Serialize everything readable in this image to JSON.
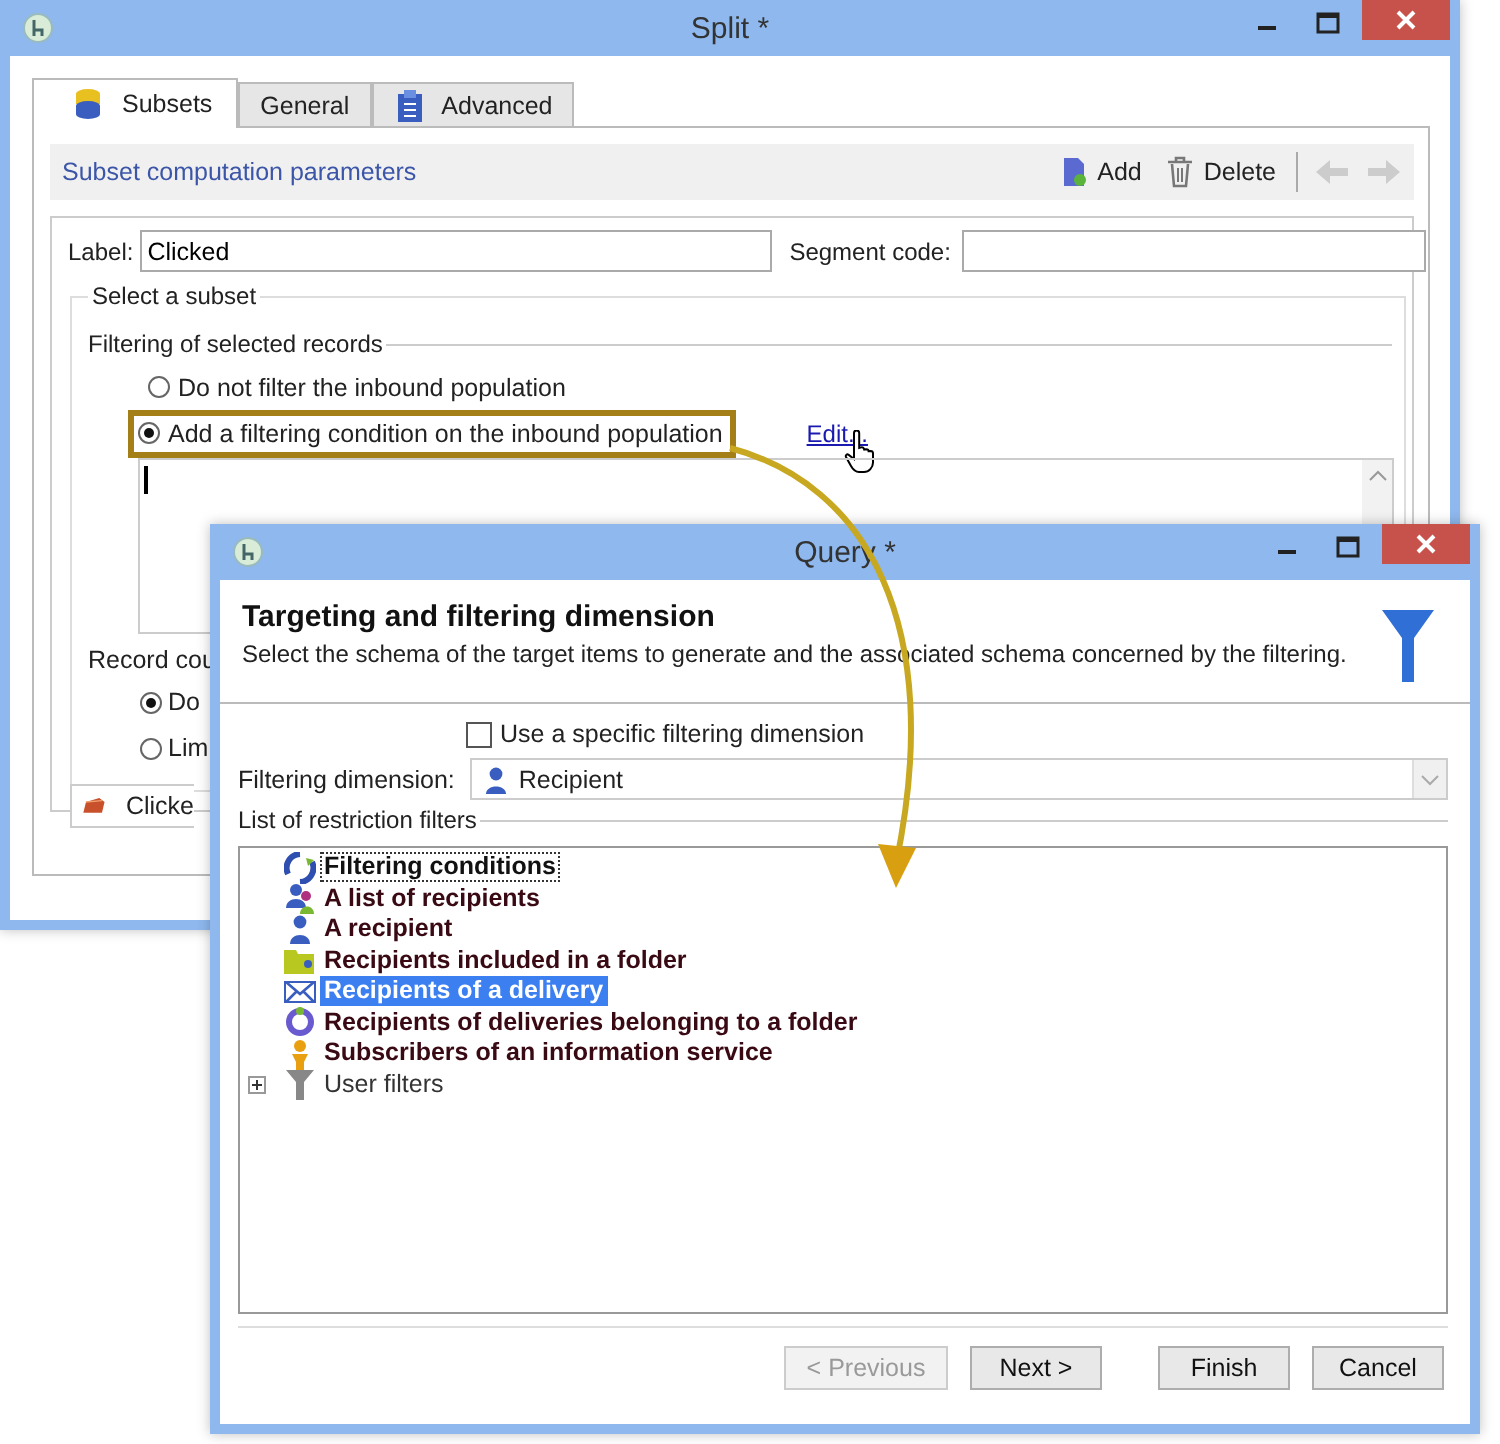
{
  "split_window": {
    "title": "Split *",
    "tabs": [
      {
        "label": "Subsets",
        "selected": true
      },
      {
        "label": "General",
        "selected": false
      },
      {
        "label": "Advanced",
        "selected": false
      }
    ],
    "section_title": "Subset computation parameters",
    "toolbar": [
      {
        "kind": "add",
        "label": "Add"
      },
      {
        "kind": "delete",
        "label": "Delete"
      },
      {
        "kind": "back",
        "disabled": true
      },
      {
        "kind": "forward",
        "disabled": true
      }
    ],
    "label_field": {
      "label": "Label:",
      "value": "Clicked"
    },
    "segment_code": {
      "label": "Segment code:"
    },
    "subset_group": "Select a subset",
    "filter_group": "Filtering of selected records",
    "filter_options": [
      {
        "label": "Do not filter the inbound population",
        "selected": false,
        "highlighted": false
      },
      {
        "label": "Add a filtering condition on the inbound population",
        "selected": true,
        "highlighted": true
      }
    ],
    "edit_link": "Edit...",
    "record_count_label": "Record cou",
    "record_options": [
      {
        "label": "Do",
        "selected": true
      },
      {
        "label": "Lim",
        "selected": false
      }
    ],
    "bottom_tab": {
      "label": "Clicke"
    }
  },
  "query_window": {
    "title": "Query *",
    "heading": "Targeting and filtering dimension",
    "description": "Select the schema of the target items to  generate and the associated schema concerned by the filtering.",
    "specific_dimension": {
      "label": "Use a specific filtering dimension",
      "checked": false
    },
    "dimension": {
      "label": "Filtering dimension:",
      "value": "Recipient"
    },
    "filters_group": "List of restriction filters",
    "filters": [
      {
        "label": "Filtering conditions",
        "kind": "filter",
        "selected": false,
        "focused": true
      },
      {
        "label": "A list of recipients",
        "kind": "filter",
        "selected": false,
        "focused": false
      },
      {
        "label": "A recipient",
        "kind": "filter",
        "selected": false,
        "focused": false
      },
      {
        "label": "Recipients included in a folder",
        "kind": "filter",
        "selected": false,
        "focused": false
      },
      {
        "label": "Recipients of a delivery",
        "kind": "filter",
        "selected": true,
        "focused": false
      },
      {
        "label": "Recipients of deliveries belonging to a folder",
        "kind": "filter",
        "selected": false,
        "focused": false
      },
      {
        "label": "Subscribers of an information service",
        "kind": "filter",
        "selected": false,
        "focused": false
      },
      {
        "label": "User filters",
        "kind": "group",
        "expanded": false,
        "selected": false,
        "focused": false
      }
    ],
    "buttons": [
      {
        "label": "< Previous",
        "disabled": true
      },
      {
        "label": "Next >",
        "disabled": false
      },
      {
        "label": "Finish",
        "disabled": false
      },
      {
        "label": "Cancel",
        "disabled": false
      }
    ]
  }
}
